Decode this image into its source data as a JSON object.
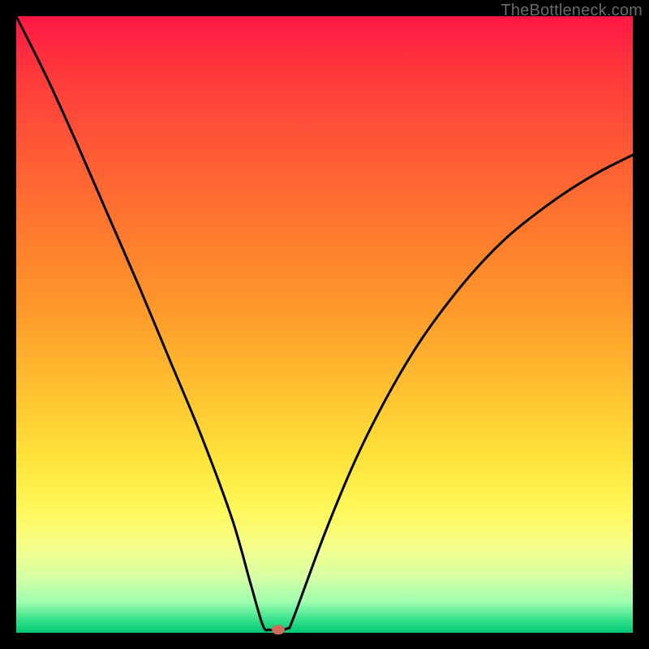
{
  "watermark": "TheBottleneck.com",
  "chart_data": {
    "type": "line",
    "title": "",
    "xlabel": "",
    "ylabel": "",
    "xlim": [
      0,
      100
    ],
    "ylim": [
      0,
      100
    ],
    "series": [
      {
        "name": "curve",
        "x": [
          0,
          5,
          10,
          15,
          20,
          25,
          30,
          35,
          38,
          40,
          41,
          42,
          44,
          45,
          50,
          55,
          60,
          65,
          70,
          75,
          80,
          85,
          90,
          95,
          100
        ],
        "y": [
          100,
          90,
          79,
          67.5,
          56,
          44,
          32,
          18.5,
          8,
          1.2,
          0.5,
          0.5,
          0.7,
          2.5,
          16,
          28,
          38,
          46.5,
          53.5,
          59.5,
          64.5,
          68.5,
          72,
          75,
          77.5
        ]
      }
    ],
    "marker": {
      "x": 42.5,
      "y": 0.5,
      "color": "#d06a5a"
    },
    "gradient_stops": [
      {
        "pos": 0,
        "color": "#ff1744"
      },
      {
        "pos": 50,
        "color": "#ffd23a"
      },
      {
        "pos": 80,
        "color": "#fff85a"
      },
      {
        "pos": 100,
        "color": "#00c774"
      }
    ]
  }
}
